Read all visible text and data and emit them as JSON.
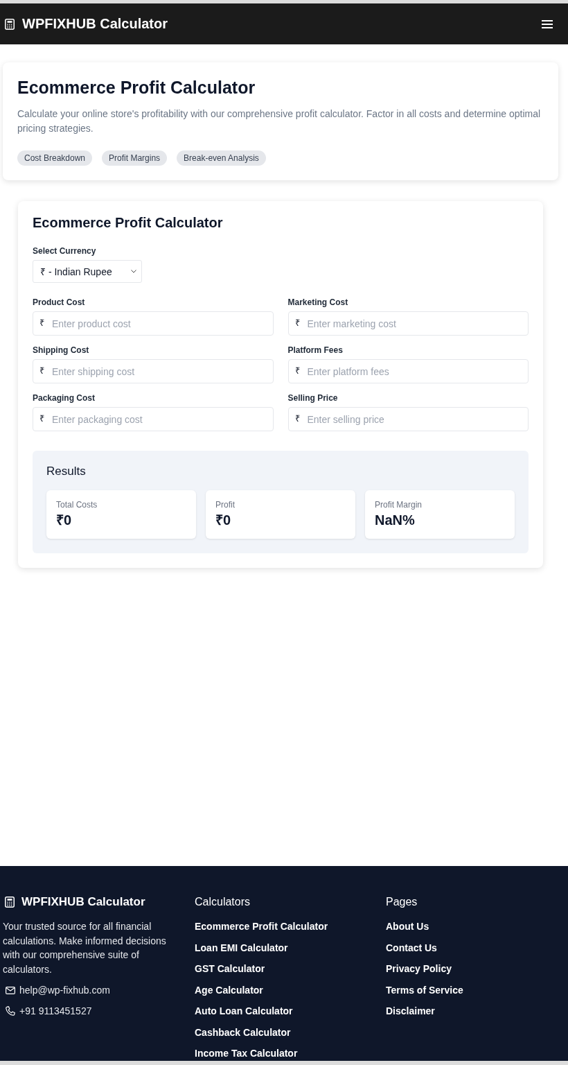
{
  "navbar": {
    "brand": "WPFIXHUB Calculator"
  },
  "hero": {
    "title": "Ecommerce Profit Calculator",
    "description": "Calculate your online store's profitability with our comprehensive profit calculator. Factor in all costs and determine optimal pricing strategies.",
    "tags": [
      "Cost Breakdown",
      "Profit Margins",
      "Break-even Analysis"
    ]
  },
  "calculator": {
    "title": "Ecommerce Profit Calculator",
    "currency": {
      "label": "Select Currency",
      "value": "₹ - Indian Rupee"
    },
    "fields": [
      {
        "label": "Product Cost",
        "prefix": "₹",
        "placeholder": "Enter product cost"
      },
      {
        "label": "Marketing Cost",
        "prefix": "₹",
        "placeholder": "Enter marketing cost"
      },
      {
        "label": "Shipping Cost",
        "prefix": "₹",
        "placeholder": "Enter shipping cost"
      },
      {
        "label": "Platform Fees",
        "prefix": "₹",
        "placeholder": "Enter platform fees"
      },
      {
        "label": "Packaging Cost",
        "prefix": "₹",
        "placeholder": "Enter packaging cost"
      },
      {
        "label": "Selling Price",
        "prefix": "₹",
        "placeholder": "Enter selling price"
      }
    ],
    "results": {
      "title": "Results",
      "cards": [
        {
          "label": "Total Costs",
          "value": "₹0"
        },
        {
          "label": "Profit",
          "value": "₹0"
        },
        {
          "label": "Profit Margin",
          "value": "NaN%"
        }
      ]
    }
  },
  "footer": {
    "brand": "WPFIXHUB Calculator",
    "description": "Your trusted source for all financial calculations. Make informed decisions with our comprehensive suite of calculators.",
    "contacts": [
      {
        "kind": "email",
        "text": "help@wp-fixhub.com"
      },
      {
        "kind": "phone",
        "text": "+91 9113451527"
      }
    ],
    "columns": [
      {
        "heading": "Calculators",
        "links": [
          "Ecommerce Profit Calculator",
          "Loan EMI Calculator",
          "GST Calculator",
          "Age Calculator",
          "Auto Loan Calculator",
          "Cashback Calculator",
          "Income Tax Calculator"
        ]
      },
      {
        "heading": "Pages",
        "links": [
          "About Us",
          "Contact Us",
          "Privacy Policy",
          "Terms of Service",
          "Disclaimer"
        ]
      }
    ]
  }
}
